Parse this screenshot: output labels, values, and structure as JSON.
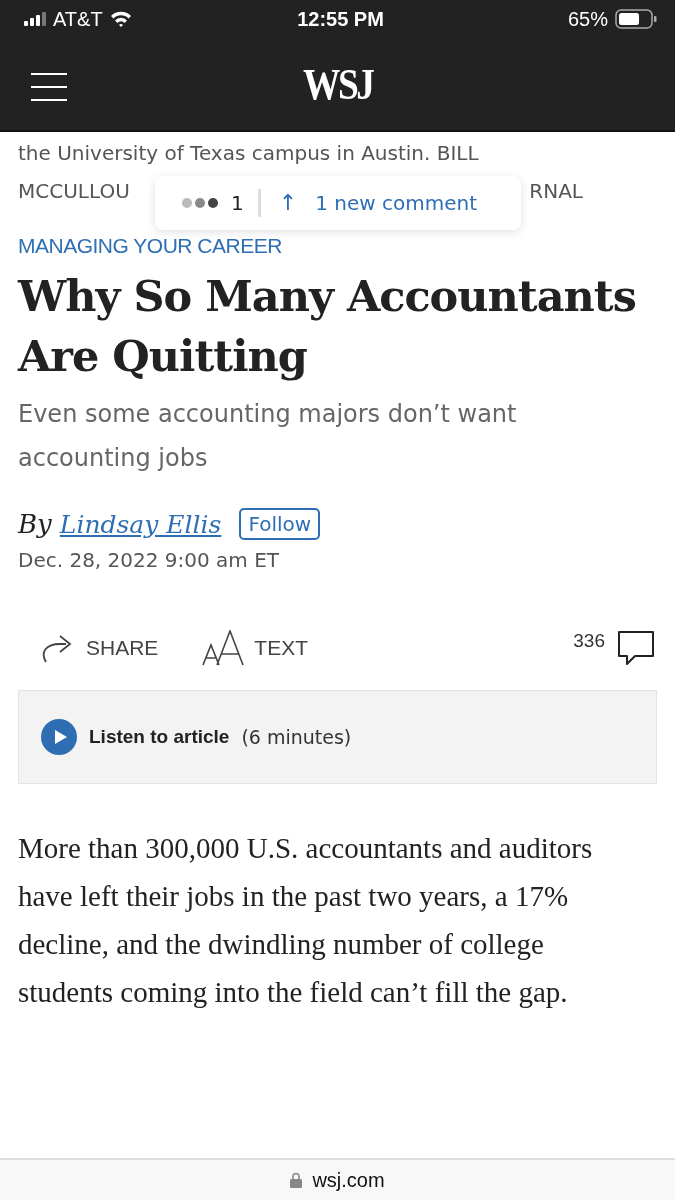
{
  "status_bar": {
    "carrier": "AT&T",
    "time": "12:55 PM",
    "battery": "65%"
  },
  "header": {
    "logo": "WSJ"
  },
  "photo_caption": {
    "line_1": "the University of Texas campus in Austin. BILL",
    "line_2_start": "MCCULLOU",
    "line_2_end": "RNAL"
  },
  "comment_toast": {
    "count": "1",
    "arrow": "↑",
    "label": "1 new comment"
  },
  "category": "MANAGING YOUR CAREER",
  "headline": "Why So Many Accountants Are Quitting",
  "subheadline": "Even some accounting majors don’t want accounting jobs",
  "byline": {
    "prefix": "By",
    "author": "Lindsay Ellis",
    "follow": "Follow"
  },
  "date": "Dec. 28, 2022 9:00 am ET",
  "toolbar": {
    "share": "SHARE",
    "text": "TEXT",
    "comments": "336"
  },
  "audio": {
    "label": "Listen to article",
    "duration": "(6 minutes)"
  },
  "body": "More than 300,000 U.S. accountants and auditors have left their jobs in the past two years, a 17% decline, and the dwindling number of college students coming into the field can’t fill the gap.",
  "address_bar": {
    "url": "wsj.com"
  }
}
